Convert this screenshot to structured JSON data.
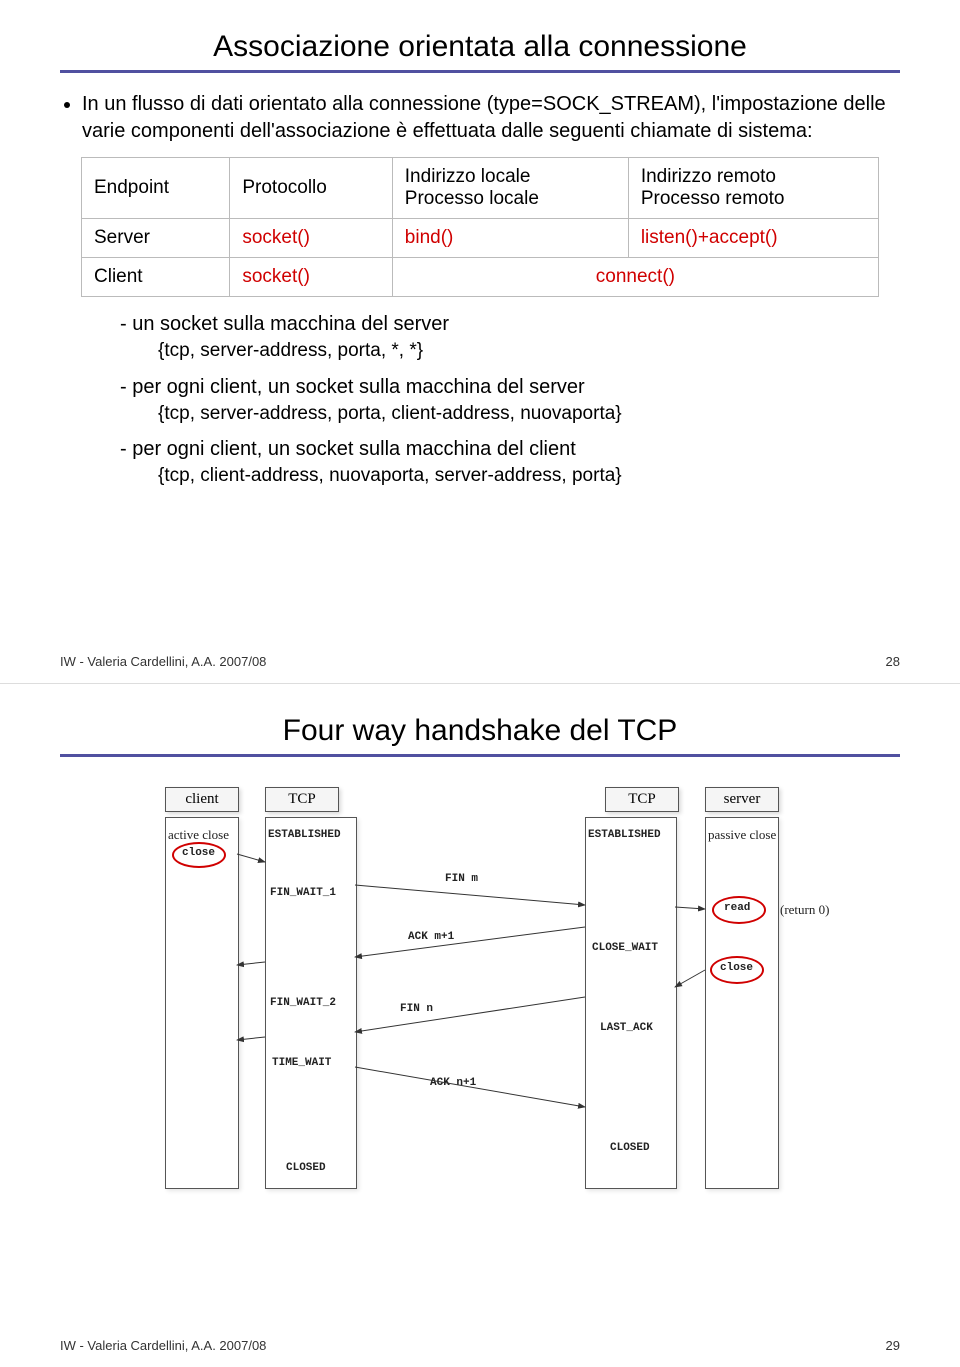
{
  "slide1": {
    "title": "Associazione orientata alla connessione",
    "bullet": "In un flusso di dati orientato alla connessione (type=SOCK_STREAM), l'impostazione delle varie componenti dell'associazione è effettuata dalle seguenti chiamate di sistema:",
    "table": {
      "r0c0": "Endpoint",
      "r0c1": "Protocollo",
      "r0c2": "Indirizzo locale\nProcesso locale",
      "r0c3": "Indirizzo remoto\nProcesso remoto",
      "r1c0": "Server",
      "r1c1": "socket()",
      "r1c2": "bind()",
      "r1c3": "listen()+accept()",
      "r2c0": "Client",
      "r2c1": "socket()",
      "r2c23": "connect()"
    },
    "item1": "- un socket sulla macchina del server",
    "item1sub": "{tcp, server-address, porta, *, *}",
    "item2": "- per ogni client, un socket sulla macchina del server",
    "item2sub": "{tcp, server-address, porta, client-address, nuovaporta}",
    "item3": "- per ogni client, un socket sulla macchina del client",
    "item3sub": "{tcp, client-address, nuovaporta, server-address, porta}",
    "footerLeft": "IW - Valeria Cardellini, A.A. 2007/08",
    "footerRight": "28"
  },
  "slide2": {
    "title": "Four way handshake del TCP",
    "labels": {
      "client": "client",
      "tcp1": "TCP",
      "tcp2": "TCP",
      "server": "server",
      "activeClose": "active close",
      "close1": "close",
      "established1": "ESTABLISHED",
      "established2": "ESTABLISHED",
      "passiveClose": "passive close",
      "finwait1": "FIN_WAIT_1",
      "finm": "FIN m",
      "read": "read",
      "return0": "(return 0)",
      "ackm1": "ACK m+1",
      "closewait": "CLOSE_WAIT",
      "close2": "close",
      "finwait2": "FIN_WAIT_2",
      "finn": "FIN n",
      "lastack": "LAST_ACK",
      "timewait": "TIME_WAIT",
      "ackn1": "ACK n+1",
      "closed1": "CLOSED",
      "closed2": "CLOSED"
    },
    "footerLeft": "IW - Valeria Cardellini, A.A. 2007/08",
    "footerRight": "29"
  }
}
